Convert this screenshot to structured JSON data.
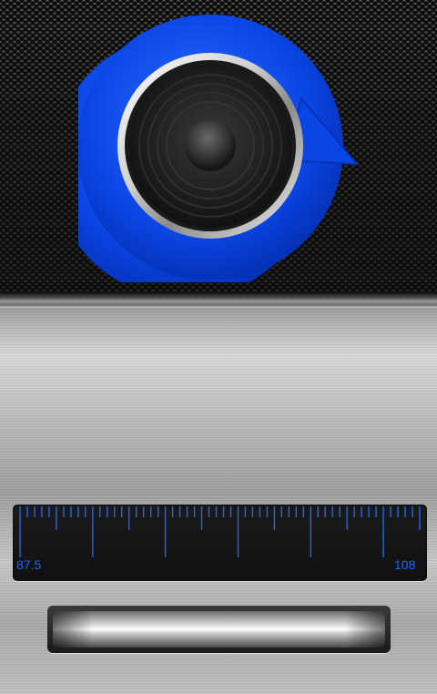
{
  "tuner": {
    "min_label": "87.5",
    "max_label": "108",
    "min_freq": 87.5,
    "max_freq": 108
  },
  "icons": {
    "logo": "speaker-refresh-icon"
  },
  "colors": {
    "accent": "#1a66ff",
    "logo_blue": "#0a3fd6",
    "grille": "#2a2a2a",
    "panel": "#bdbdbd"
  }
}
